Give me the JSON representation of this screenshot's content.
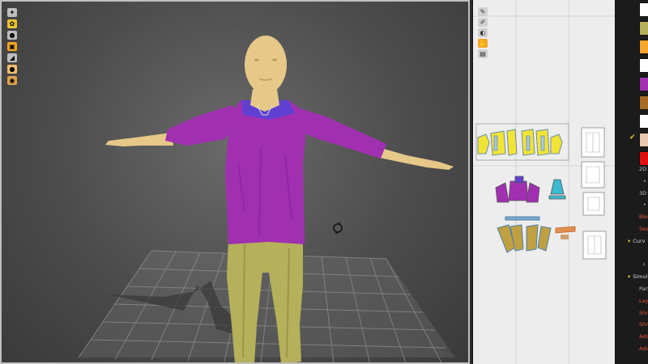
{
  "viewport3d": {
    "toolbar": [
      {
        "icon": "avatar-display-icon",
        "color": "#bdbdbd"
      },
      {
        "icon": "texture-display-icon",
        "color": "#e8c233"
      },
      {
        "icon": "avatar-icon",
        "color": "#bdbdbd"
      },
      {
        "icon": "garment-display-icon",
        "color": "#f5a623"
      },
      {
        "icon": "simulation-quality-icon",
        "color": "#bdbdbd"
      },
      {
        "icon": "skin-icon",
        "color": "#f0c070"
      },
      {
        "icon": "body-shade-icon",
        "color": "#e0a050"
      }
    ],
    "colors": {
      "top": "#a030b0",
      "top_inner": "#6040d0",
      "pants": "#b5b05a",
      "skin": "#e6c888",
      "grid": "#8a8a8a"
    }
  },
  "viewport2d": {
    "toolbar": [
      {
        "icon": "pen-tool-icon"
      },
      {
        "icon": "brush-tool-icon"
      },
      {
        "icon": "button-tool-icon"
      },
      {
        "icon": "hand-tool-icon"
      },
      {
        "icon": "layer-tool-icon"
      }
    ]
  },
  "panel": {
    "swatches": [
      {
        "color": "#ffffff",
        "checked": false
      },
      {
        "color": "#b5b05a",
        "checked": false
      },
      {
        "color": "#f7a531",
        "checked": false
      },
      {
        "color": "#ffffff",
        "checked": false
      },
      {
        "color": "#a030b0",
        "checked": false
      },
      {
        "color": "#a66a22",
        "checked": false
      },
      {
        "color": "#ffffff",
        "checked": false
      },
      {
        "color": "#e8c8b0",
        "checked": true
      },
      {
        "color": "#e01010",
        "checked": false
      }
    ],
    "items": [
      {
        "label": "2D",
        "style": "plain"
      },
      {
        "label": "•",
        "style": "small"
      },
      {
        "label": "3D",
        "style": "plain"
      },
      {
        "label": "•",
        "style": "small"
      },
      {
        "label": "Blen",
        "style": "red"
      },
      {
        "label": "Sea",
        "style": "red"
      },
      {
        "label": "Curv",
        "style": "hdr"
      },
      {
        "label": "",
        "style": "plain"
      },
      {
        "label": "I",
        "style": "small"
      },
      {
        "label": "Simulat",
        "style": "hdr"
      },
      {
        "label": "Part",
        "style": "plain"
      },
      {
        "label": "Lay",
        "style": "red"
      },
      {
        "label": "Shri",
        "style": "red"
      },
      {
        "label": "Shri",
        "style": "red"
      },
      {
        "label": "Add",
        "style": "red"
      },
      {
        "label": "Add",
        "style": "red"
      }
    ]
  }
}
